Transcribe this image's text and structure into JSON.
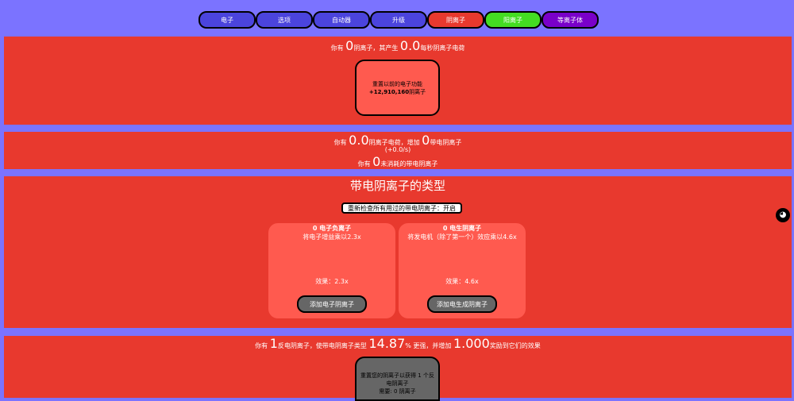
{
  "tabs": [
    {
      "label": "电子"
    },
    {
      "label": "选项"
    },
    {
      "label": "自动器"
    },
    {
      "label": "升级"
    },
    {
      "label": "阴离子"
    },
    {
      "label": "阳离子"
    },
    {
      "label": "等离子体"
    }
  ],
  "anion": {
    "have_prefix": "你有",
    "amount": "0",
    "mid": "阴离子，其产生",
    "rate": "0.0",
    "suffix": "每秒阴离子电荷",
    "reset_line1": "重置以前的电子功能",
    "reset_gain": "+12,910,160",
    "reset_unit": "阴离子"
  },
  "charge": {
    "have_prefix": "你有",
    "amount": "0.0",
    "mid": "阴离子电荷，增加",
    "charged": "0",
    "suffix": "带电阴离子",
    "rate": "(+0.0/s)",
    "unspent_prefix": "你有",
    "unspent": "0",
    "unspent_suffix": "未消耗的带电阴离子"
  },
  "types": {
    "title": "带电阴离子的类型",
    "toggle": "重新检查所有用过的带电阴离子：开启",
    "cards": [
      {
        "name": "0 电子负离子",
        "desc": "将电子增益乘以2.3x",
        "effect": "效果：2.3x",
        "button": "添加电子阴离子"
      },
      {
        "name": "0 电生阴离子",
        "desc": "将发电机（除了第一个）效应乘以4.6x",
        "effect": "效果：4.6x",
        "button": "添加电生成阴离子"
      }
    ]
  },
  "anti": {
    "p1": "你有",
    "amount": "1",
    "p2": "反电阴离子，使带电阴离子类型",
    "pct": "14.87",
    "p3": "% 更强，并增加",
    "bonus": "1.000",
    "p4": "奖励到它们的效果",
    "reset_line1": "重置您的阴离子以获得 1 个反",
    "reset_line2": "电阴离子",
    "reset_line3": "需要: 0 阴离子"
  }
}
